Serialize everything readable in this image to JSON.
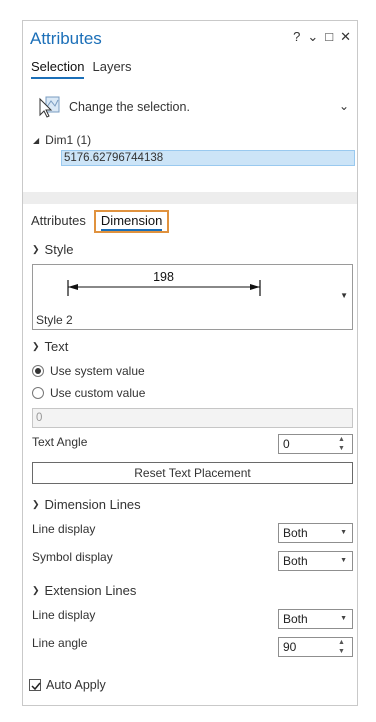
{
  "header": {
    "title": "Attributes",
    "help_icon": "?",
    "menu_icon": "⌄",
    "maximize_icon": "□",
    "close_icon": "✕"
  },
  "top_tabs": [
    {
      "label": "Selection",
      "active": true
    },
    {
      "label": "Layers",
      "active": false
    }
  ],
  "selection": {
    "text": "Change the selection.",
    "chevron": "⌄"
  },
  "tree": {
    "node_label": "Dim1  (1)",
    "selected_value": "5176.62796744138"
  },
  "sub_tabs": [
    {
      "label": "Attributes",
      "active": false
    },
    {
      "label": "Dimension",
      "active": true
    }
  ],
  "style_section": {
    "header": "Style",
    "preview_value": "198",
    "selected_style": "Style 2"
  },
  "text_section": {
    "header": "Text",
    "options": [
      {
        "label": "Use system value",
        "selected": true
      },
      {
        "label": "Use custom value",
        "selected": false
      }
    ],
    "custom_value": "0",
    "angle_label": "Text Angle",
    "angle_value": "0",
    "reset_button": "Reset Text Placement"
  },
  "dimension_lines": {
    "header": "Dimension Lines",
    "line_display_label": "Line display",
    "line_display_value": "Both",
    "symbol_display_label": "Symbol display",
    "symbol_display_value": "Both"
  },
  "extension_lines": {
    "header": "Extension Lines",
    "line_display_label": "Line display",
    "line_display_value": "Both",
    "line_angle_label": "Line angle",
    "line_angle_value": "90"
  },
  "auto_apply": {
    "label": "Auto Apply",
    "checked": true
  },
  "colors": {
    "accent": "#1b6fb8",
    "highlight_border": "#e0923e",
    "selection_bg": "#cce4f7"
  }
}
